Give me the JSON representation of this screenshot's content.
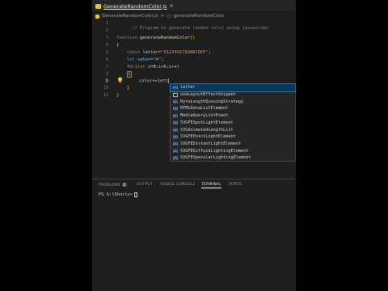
{
  "tab": {
    "label": "GenerateRandomColor.js",
    "icon": "js-file-icon"
  },
  "breadcrumb": {
    "file": "GenerateRandomColor.js",
    "separator": ">",
    "function": "generateRandomColor"
  },
  "editor": {
    "line_numbers": [
      "1",
      "2",
      "3",
      "4",
      "5",
      "6",
      "7",
      "8",
      "9",
      "10",
      "11"
    ],
    "active_line": "9",
    "lines": {
      "l1": {
        "comment": "// Program to generate random color using javascript"
      },
      "l3": {
        "kw": "function",
        "name": "generateRandomColor",
        "tail": "()"
      },
      "l4": {
        "brace": "{"
      },
      "l5": {
        "kw": "const",
        "var": "letter",
        "eq": "=",
        "str": "\"0123456789ABCDEF\"",
        "end": ";"
      },
      "l6": {
        "kw": "let",
        "var": "color",
        "eq": "=",
        "str": "\"#\"",
        "end": ";"
      },
      "l7": {
        "kw": "for",
        "open": "(",
        "kw2": "let",
        "body": " i=0;i<6;i++",
        "close": ")"
      },
      "l8": {
        "brace": "{"
      },
      "l9": {
        "var": "color",
        "op": "+=",
        "typed": "lett"
      },
      "l10": {
        "brace": "}"
      },
      "l11": {
        "brace": "}"
      }
    }
  },
  "suggestions": [
    {
      "label": "letter",
      "icon": "variable-icon"
    },
    {
      "label": "useLayoutEffectSnippet",
      "icon": "snippet-icon"
    },
    {
      "label": "ByteLengthQueuingStrategy",
      "icon": "variable-icon"
    },
    {
      "label": "HTMLDataListElement",
      "icon": "variable-icon"
    },
    {
      "label": "MediaQueryListEvent",
      "icon": "variable-icon"
    },
    {
      "label": "SVGFESpotLightElement",
      "icon": "variable-icon"
    },
    {
      "label": "SVGAnimatedLengthList",
      "icon": "variable-icon"
    },
    {
      "label": "SVGFEPointLightElement",
      "icon": "variable-icon"
    },
    {
      "label": "SVGFEDistantLightElement",
      "icon": "variable-icon"
    },
    {
      "label": "SVGFEDiffuseLightingElement",
      "icon": "variable-icon"
    },
    {
      "label": "SVGFESpecularLightingElement",
      "icon": "variable-icon"
    }
  ],
  "panel": {
    "tabs": [
      "PROBLEMS",
      "OUTPUT",
      "DEBUG CONSOLE",
      "TERMINAL",
      "PORTS"
    ],
    "problems_count": "1",
    "active_tab": "TERMINAL"
  },
  "terminal": {
    "prompt": "PS G:\\Shorts>"
  },
  "colors": {
    "accent": "#007fd4",
    "editor_bg": "#1e1e1e",
    "js_badge": "#e2c541"
  }
}
